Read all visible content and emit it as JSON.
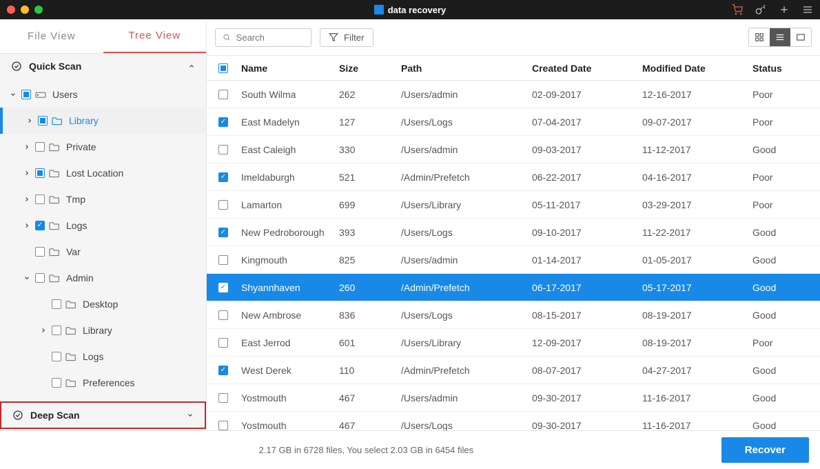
{
  "app": {
    "title": "data recovery"
  },
  "toolbar_icons": [
    "cart",
    "key",
    "plus",
    "menu"
  ],
  "sidebar": {
    "tabs": [
      {
        "label": "File  View",
        "active": false
      },
      {
        "label": "Tree  View",
        "active": true
      }
    ],
    "scan_sections": [
      {
        "label": "Quick Scan",
        "expanded": true,
        "highlighted": false
      },
      {
        "label": "Deep Scan",
        "expanded": false,
        "highlighted": true
      }
    ],
    "tree": [
      {
        "level": 0,
        "label": "Users",
        "chev": "down",
        "cb": "indeterminate",
        "icon": "drive"
      },
      {
        "level": 1,
        "label": "Library",
        "chev": "right",
        "cb": "indeterminate",
        "icon": "folder",
        "selected": true
      },
      {
        "level": 1,
        "label": "Private",
        "chev": "right",
        "cb": "unchecked",
        "icon": "folder"
      },
      {
        "level": 1,
        "label": "Lost Location",
        "chev": "right",
        "cb": "indeterminate",
        "icon": "folder"
      },
      {
        "level": 1,
        "label": "Tmp",
        "chev": "right",
        "cb": "unchecked",
        "icon": "folder"
      },
      {
        "level": 1,
        "label": "Logs",
        "chev": "right",
        "cb": "checked",
        "icon": "folder"
      },
      {
        "level": 1,
        "label": "Var",
        "chev": "none",
        "cb": "unchecked",
        "icon": "folder"
      },
      {
        "level": 1,
        "label": "Admin",
        "chev": "down",
        "cb": "unchecked",
        "icon": "folder"
      },
      {
        "level": 2,
        "label": "Desktop",
        "chev": "none",
        "cb": "unchecked",
        "icon": "folder"
      },
      {
        "level": 2,
        "label": "Library",
        "chev": "right",
        "cb": "unchecked",
        "icon": "folder"
      },
      {
        "level": 2,
        "label": "Logs",
        "chev": "none",
        "cb": "unchecked",
        "icon": "folder"
      },
      {
        "level": 2,
        "label": "Preferences",
        "chev": "none",
        "cb": "unchecked",
        "icon": "folder"
      }
    ]
  },
  "search": {
    "placeholder": "Search"
  },
  "filter": {
    "label": "Filter"
  },
  "view_modes": [
    "grid",
    "list",
    "preview"
  ],
  "active_view_mode": "list",
  "table": {
    "columns": [
      "Name",
      "Size",
      "Path",
      "Created Date",
      "Modified Date",
      "Status"
    ],
    "rows": [
      {
        "cb": "unchecked",
        "name": "South Wilma",
        "size": "262",
        "path": "/Users/admin",
        "created": "02-09-2017",
        "modified": "12-16-2017",
        "status": "Poor"
      },
      {
        "cb": "checked",
        "name": "East Madelyn",
        "size": "127",
        "path": "/Users/Logs",
        "created": "07-04-2017",
        "modified": "09-07-2017",
        "status": "Poor"
      },
      {
        "cb": "unchecked",
        "name": "East Caleigh",
        "size": "330",
        "path": "/Users/admin",
        "created": "09-03-2017",
        "modified": "11-12-2017",
        "status": "Good"
      },
      {
        "cb": "checked",
        "name": "Imeldaburgh",
        "size": "521",
        "path": "/Admin/Prefetch",
        "created": "06-22-2017",
        "modified": "04-16-2017",
        "status": "Poor"
      },
      {
        "cb": "unchecked",
        "name": "Lamarton",
        "size": "699",
        "path": "/Users/Library",
        "created": "05-11-2017",
        "modified": "03-29-2017",
        "status": "Poor"
      },
      {
        "cb": "checked",
        "name": "New Pedroborough",
        "size": "393",
        "path": "/Users/Logs",
        "created": "09-10-2017",
        "modified": "11-22-2017",
        "status": "Good"
      },
      {
        "cb": "unchecked",
        "name": "Kingmouth",
        "size": "825",
        "path": "/Users/admin",
        "created": "01-14-2017",
        "modified": "01-05-2017",
        "status": "Good"
      },
      {
        "cb": "checked",
        "name": "Shyannhaven",
        "size": "260",
        "path": "/Admin/Prefetch",
        "created": "06-17-2017",
        "modified": "05-17-2017",
        "status": "Good",
        "selected": true
      },
      {
        "cb": "unchecked",
        "name": "New Ambrose",
        "size": "836",
        "path": "/Users/Logs",
        "created": "08-15-2017",
        "modified": "08-19-2017",
        "status": "Good"
      },
      {
        "cb": "unchecked",
        "name": "East Jerrod",
        "size": "601",
        "path": "/Users/Library",
        "created": "12-09-2017",
        "modified": "08-19-2017",
        "status": "Poor"
      },
      {
        "cb": "checked",
        "name": "West Derek",
        "size": "110",
        "path": "/Admin/Prefetch",
        "created": "08-07-2017",
        "modified": "04-27-2017",
        "status": "Good"
      },
      {
        "cb": "unchecked",
        "name": "Yostmouth",
        "size": "467",
        "path": "/Users/admin",
        "created": "09-30-2017",
        "modified": "11-16-2017",
        "status": "Good"
      },
      {
        "cb": "unchecked",
        "name": "Yostmouth",
        "size": "467",
        "path": "/Users/Logs",
        "created": "09-30-2017",
        "modified": "11-16-2017",
        "status": "Good"
      }
    ]
  },
  "footer": {
    "status": "2.17 GB in 6728 files, You select 2.03 GB in 6454 files",
    "recover_label": "Recover"
  }
}
